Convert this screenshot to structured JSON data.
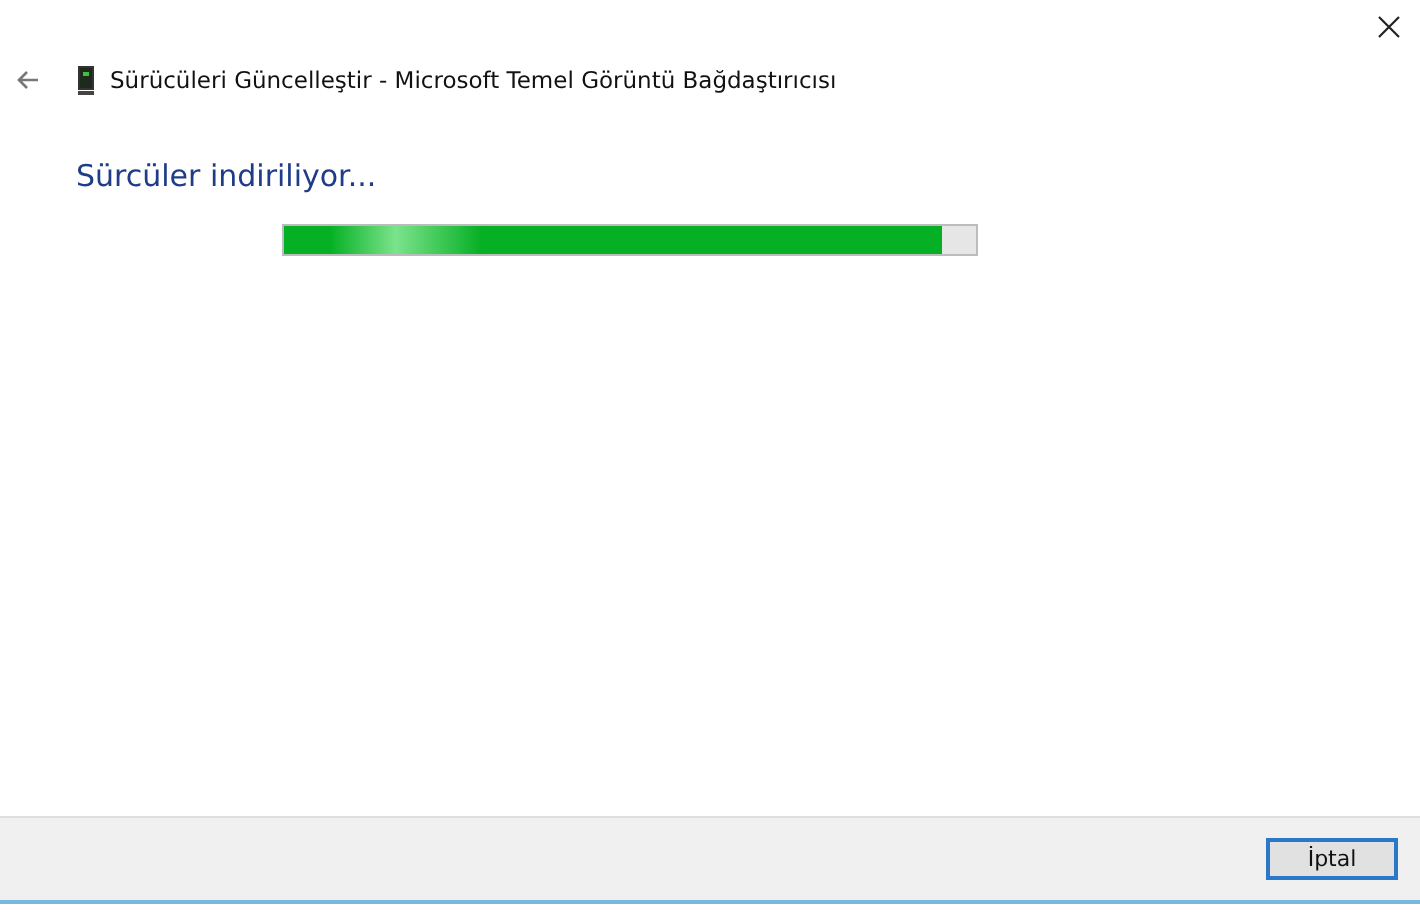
{
  "window": {
    "title": "Sürücüleri Güncelleştir - Microsoft Temel Görüntü Bağdaştırıcısı"
  },
  "heading": "Sürcüler indiriliyor...",
  "progress": {
    "level": 0.95
  },
  "buttons": [
    {
      "label": "İptal"
    }
  ]
}
